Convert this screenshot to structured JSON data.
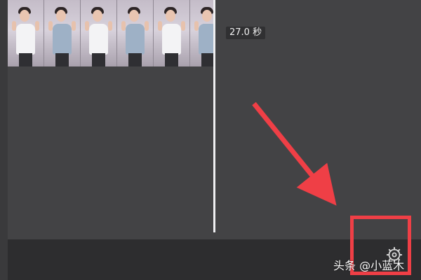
{
  "timeline": {
    "duration_label": "27.0 秒",
    "frame_count": 6
  },
  "icons": {
    "settings": "gear-icon"
  },
  "annotations": {
    "arrow_color": "#ef3f46",
    "highlight_color": "#ef3f46"
  },
  "watermark": {
    "text": "头条 @小蓝木"
  }
}
